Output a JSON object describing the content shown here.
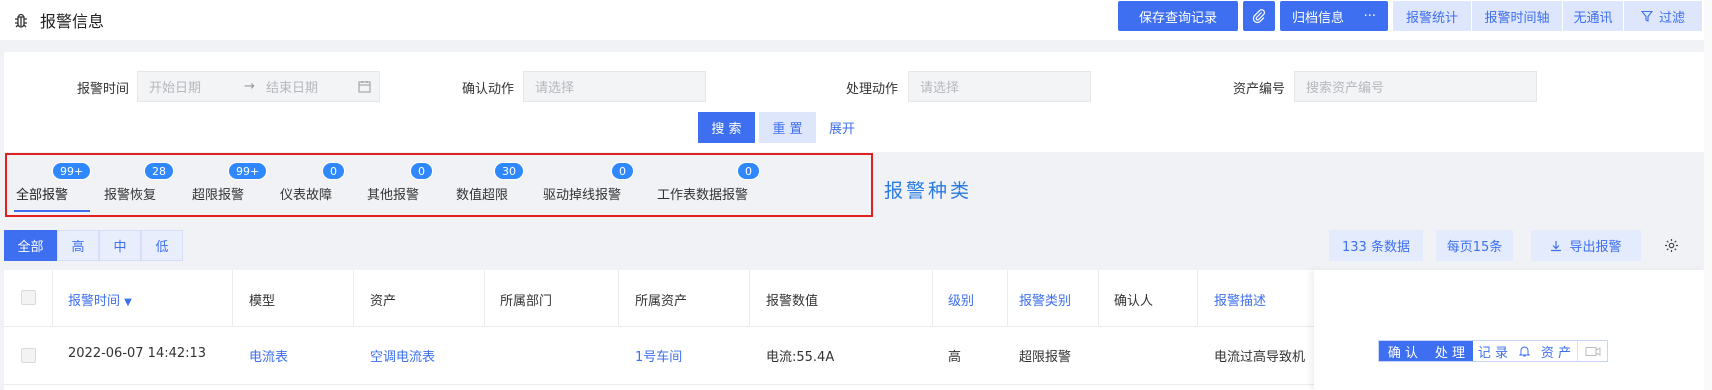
{
  "header": {
    "title": "报警信息",
    "buttons": {
      "save_query": "保存查询记录",
      "archive": "归档信息",
      "more": "···",
      "stats": "报警统计",
      "timeline": "报警时间轴",
      "no_comm": "无通讯",
      "filter": "过滤"
    }
  },
  "search": {
    "alarm_time_label": "报警时间",
    "start_placeholder": "开始日期",
    "range_arrow": "→",
    "end_placeholder": "结束日期",
    "confirm_label": "确认动作",
    "confirm_placeholder": "请选择",
    "handle_label": "处理动作",
    "handle_placeholder": "请选择",
    "asset_label": "资产编号",
    "asset_placeholder": "搜索资产编号",
    "search_btn": "搜 索",
    "reset_btn": "重 置",
    "expand_link": "展开"
  },
  "tabs": [
    {
      "label": "全部报警",
      "count": "99+"
    },
    {
      "label": "报警恢复",
      "count": "28"
    },
    {
      "label": "超限报警",
      "count": "99+"
    },
    {
      "label": "仪表故障",
      "count": "0"
    },
    {
      "label": "其他报警",
      "count": "0"
    },
    {
      "label": "数值超限",
      "count": "30"
    },
    {
      "label": "驱动掉线报警",
      "count": "0"
    },
    {
      "label": "工作表数据报警",
      "count": "0"
    }
  ],
  "annotation": "报警种类",
  "levels": [
    "全部",
    "高",
    "中",
    "低"
  ],
  "right_tools": {
    "count": "133 条数据",
    "per_page": "每页15条",
    "export": "导出报警"
  },
  "table": {
    "headers": {
      "time": "报警时间",
      "model": "模型",
      "asset": "资产",
      "dept": "所属部门",
      "parent_asset": "所属资产",
      "value": "报警数值",
      "level": "级别",
      "category": "报警类别",
      "confirmer": "确认人",
      "desc": "报警描述"
    },
    "row": {
      "time": "2022-06-07 14:42:13",
      "model": "电流表",
      "asset": "空调电流表",
      "dept": "",
      "parent_asset": "1号车间",
      "value": "电流:55.4A",
      "level": "高",
      "category": "超限报警",
      "confirmer": "",
      "desc": "电流过高导致机",
      "ops": {
        "confirm": "确 认",
        "handle": "处 理",
        "record": "记 录",
        "asset": "资 产"
      }
    }
  },
  "colors": {
    "primary": "#3e6ff0",
    "badge": "#2f88ff",
    "highlight_border": "#e02020",
    "annotation": "#2a7be0"
  }
}
